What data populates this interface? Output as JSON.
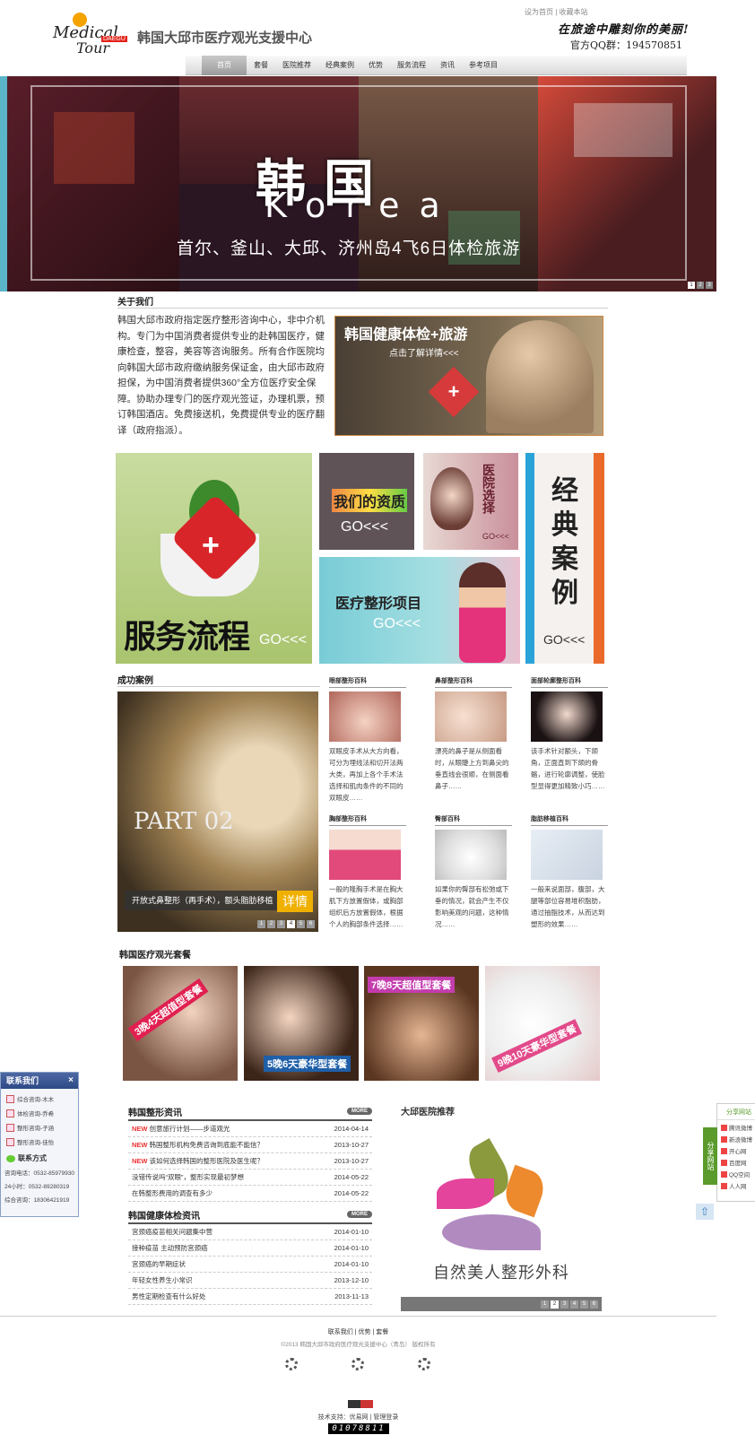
{
  "header": {
    "logo_text_1": "Medical",
    "logo_text_2": "Tour",
    "logo_tag": "DAEGU",
    "site_title": "韩国大邱市医疗观光支援中心",
    "top_links": "设为首页 | 收藏本站",
    "slogan": "在旅途中雕刻你的美丽!",
    "qq": "官方QQ群：194570851"
  },
  "nav": {
    "items": [
      "首页",
      "套餐",
      "医院推荐",
      "经典案例",
      "优势",
      "服务流程",
      "资讯",
      "参考项目"
    ]
  },
  "banner": {
    "title": "韩国",
    "subtitle": "Korea",
    "caption": "首尔、釜山、大邱、济州岛4飞6日体检旅游",
    "pages": [
      "1",
      "2",
      "3"
    ]
  },
  "about": {
    "title": "关于我们",
    "text": "韩国大邱市政府指定医疗整形咨询中心，非中介机构。专门为中国消费者提供专业的赴韩国医疗，健康检查，整容，美容等咨询服务。所有合作医院均向韩国大邱市政府缴纳服务保证金，由大邱市政府担保，为中国消费者提供360°全方位医疗安全保障。协助办理专门的医疗观光签证，办理机票，预订韩国酒店。免费接送机，免费提供专业的医疗翻译（政府指派）。",
    "ad_title": "韩国健康体检+旅游",
    "ad_sub": "点击了解详情<<<"
  },
  "tiles": {
    "service": "服务流程",
    "service_go": "GO<<<",
    "qual": "我们的资质",
    "qual_go": "GO<<<",
    "hosp": "医院选择",
    "hosp_go": "GO<<<",
    "proj": "医疗整形项目",
    "proj_go": "GO<<<",
    "cases": "经典案例",
    "cases_go": "GO<<<"
  },
  "success": {
    "title": "成功案例",
    "part": "PART 02",
    "caption": "开放式鼻整形（再手术），额头脂肪移植",
    "more": "详情",
    "pages": [
      "1",
      "2",
      "3",
      "4",
      "5",
      "6"
    ],
    "cases": [
      {
        "title": "眼部整形百科",
        "desc": "双眼皮手术从大方向看，可分为埋线法和切开法两大类，再加上各个手术法选择和肌肉条件的不同的双眼皮……"
      },
      {
        "title": "鼻部整形百科",
        "desc": "漂亮的鼻子是从侧面看时，从眼睫上方到鼻尖的垂直线会很顺，在侧面看鼻子……"
      },
      {
        "title": "面部轮廓整形百科",
        "desc": "该手术针对额头，下颌角，正面直到下颌的骨骼，进行轮廓调整，使脸型显得更加精致小巧……"
      },
      {
        "title": "胸部整形百科",
        "desc": "一般的隆胸手术是在胸大肌下方放置假体，或胸部组织后方放置假体，根据个人的胸部条件选择……"
      },
      {
        "title": "臀部百科",
        "desc": "如果你的臀部有松弛或下垂的情况，就会产生不仅影响美观的问题，这种情况……"
      },
      {
        "title": "脂肪移植百科",
        "desc": "一般来说面部，腹部，大腿等部位容易堆积脂肪，通过抽脂技术，从而达到塑形的效果……"
      }
    ]
  },
  "packages": {
    "title": "韩国医疗观光套餐",
    "items": [
      "3晚4天超值型套餐",
      "5晚6天豪华型套餐",
      "7晚8天超值型套餐",
      "9晚10天豪华型套餐"
    ]
  },
  "contact": {
    "title": "联系我们",
    "close": "×",
    "items": [
      "综合咨询-木木",
      "体检咨询-乔希",
      "整形咨询-子涵",
      "整形咨询-佳怡"
    ],
    "sub": "联系方式",
    "lines": [
      "咨询电话：0532-85979930",
      "24小时：0532-89280319",
      "综合咨询：18306421919"
    ]
  },
  "share": {
    "header": "分享网站",
    "tab": "分享网站",
    "items": [
      "腾讯微博",
      "新浪微博",
      "开心网",
      "百度网",
      "QQ空间",
      "人人网"
    ]
  },
  "news": {
    "plastic": {
      "title": "韩国整形资讯",
      "more": "MORE",
      "rows": [
        {
          "hot": true,
          "text": "创意旅行计划——步道观光",
          "date": "2014-04-14"
        },
        {
          "hot": true,
          "text": "韩国整形机构免费咨询到底能不能信？",
          "date": "2013-10-27"
        },
        {
          "hot": true,
          "text": "该如何选择韩国的整形医院及医生呢？",
          "date": "2013-10-27"
        },
        {
          "hot": false,
          "text": "没错传说吗“双眼”，整形实现最初梦想",
          "date": "2014-05-22"
        },
        {
          "hot": false,
          "text": "在韩整形费用的调查有多少",
          "date": "2014-05-22"
        }
      ]
    },
    "health": {
      "title": "韩国健康体检资讯",
      "more": "MORE",
      "rows": [
        {
          "text": "宫颈癌疫苗相关问题集中营",
          "date": "2014-01-10"
        },
        {
          "text": "接种疫苗 主动预防宫颈癌",
          "date": "2014-01-10"
        },
        {
          "text": "宫颈癌的早期症状",
          "date": "2014-01-10"
        },
        {
          "text": "年轻女性养生小常识",
          "date": "2013-12-10"
        },
        {
          "text": "男性定期检查有什么好处",
          "date": "2013-11-13"
        }
      ]
    },
    "rec_title": "大邱医院推荐",
    "rec_name": "自然美人整形外科",
    "rec_pages": [
      "1",
      "2",
      "3",
      "4",
      "5",
      "6"
    ]
  },
  "footer": {
    "links": "联系我们 | 优势 | 套餐",
    "copyright": "©2013 韩国大邱市政府医疗观光支援中心（青岛） 版权所有",
    "tech": "技术支持：优易网 | 管理登录",
    "counter": "01078811"
  }
}
